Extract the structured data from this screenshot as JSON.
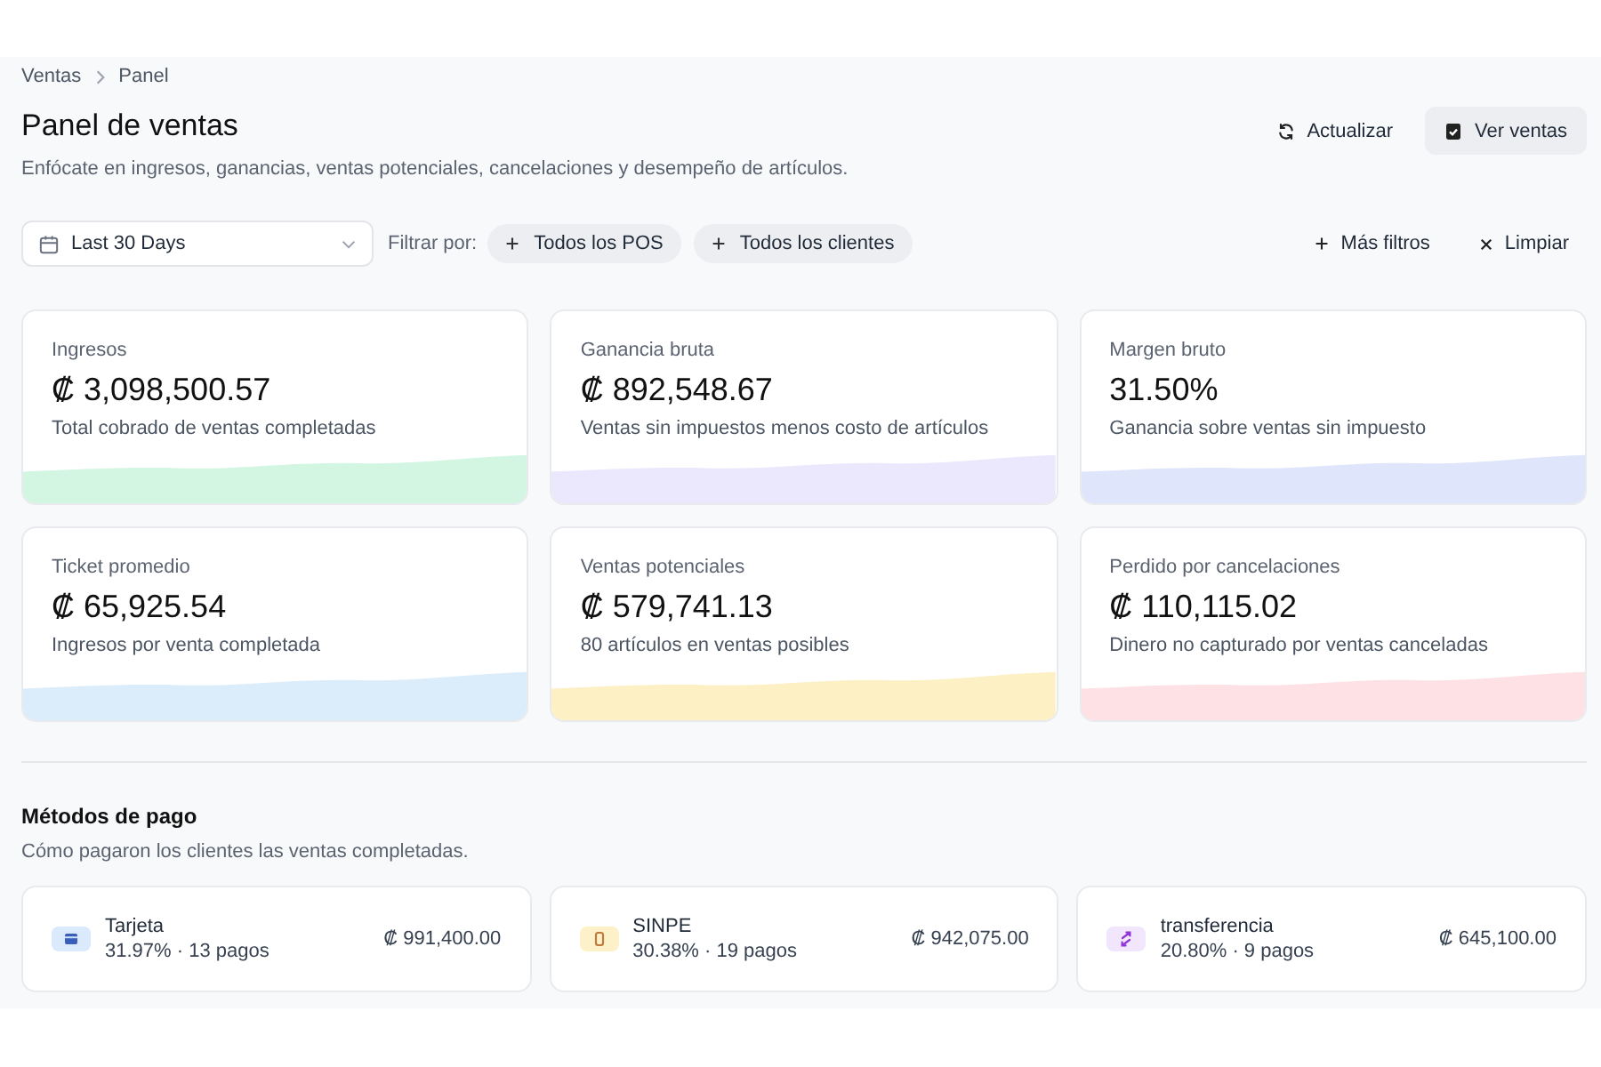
{
  "breadcrumb": [
    {
      "label": "Ventas"
    },
    {
      "label": "Panel"
    }
  ],
  "header": {
    "title": "Panel de ventas",
    "subtitle": "Enfócate en ingresos, ganancias, ventas potenciales, cancelaciones y desempeño de artículos.",
    "actions": [
      {
        "label": "Actualizar",
        "kind": "refresh"
      },
      {
        "label": "Ver ventas",
        "kind": "view"
      }
    ]
  },
  "filters": {
    "date_range": {
      "value": "Last 30 Days"
    },
    "label": "Filtrar por:",
    "chips": [
      {
        "label": "Todos los POS"
      },
      {
        "label": "Todos los clientes"
      }
    ],
    "actions": [
      {
        "label": "Más filtros",
        "kind": "add"
      },
      {
        "label": "Limpiar",
        "kind": "clear"
      }
    ]
  },
  "metrics": [
    {
      "label": "Ingresos",
      "value": "₡ 3,098,500.57",
      "description": "Total cobrado de ventas completadas",
      "color": "#d2f6e2"
    },
    {
      "label": "Ganancia bruta",
      "value": "₡ 892,548.67",
      "description": "Ventas sin impuestos menos costo de artículos",
      "color": "#ebe7fc"
    },
    {
      "label": "Margen bruto",
      "value": "31.50%",
      "description": "Ganancia sobre ventas sin impuesto",
      "color": "#dfe5fb"
    },
    {
      "label": "Ticket promedio",
      "value": "₡ 65,925.54",
      "description": "Ingresos por venta completada",
      "color": "#dbedfb"
    },
    {
      "label": "Ventas potenciales",
      "value": "₡ 579,741.13",
      "description": "80 artículos en ventas posibles",
      "color": "#fdf0c4"
    },
    {
      "label": "Perdido por cancelaciones",
      "value": "₡ 110,115.02",
      "description": "Dinero no capturado por ventas canceladas",
      "color": "#fde1e4"
    }
  ],
  "payment_methods": {
    "title": "Métodos de pago",
    "subtitle": "Cómo pagaron los clientes las ventas completadas.",
    "items": [
      {
        "name": "Tarjeta",
        "share": "31.97% · 13 pagos",
        "amount": "₡ 991,400.00",
        "kind": "card",
        "color": "#dbe9fd"
      },
      {
        "name": "SINPE",
        "share": "30.38% · 19 pagos",
        "amount": "₡ 942,075.00",
        "kind": "phone",
        "color": "#fdf1c9"
      },
      {
        "name": "transferencia",
        "share": "20.80% · 9 pagos",
        "amount": "₡ 645,100.00",
        "kind": "transfer",
        "color": "#f2e6fd"
      }
    ]
  }
}
